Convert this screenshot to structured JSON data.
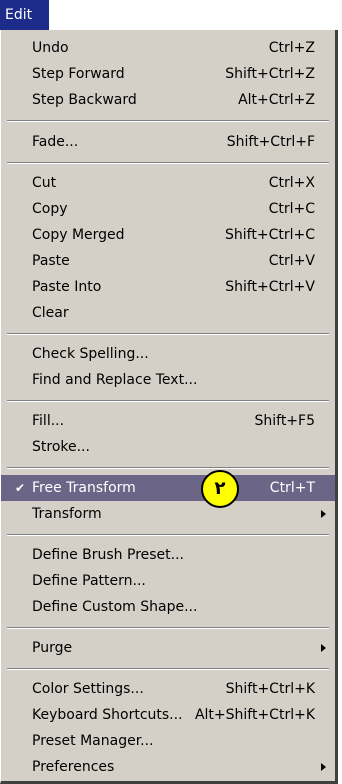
{
  "menubar": {
    "title": "Edit"
  },
  "menu": {
    "undo": {
      "label": "Undo",
      "shortcut": "Ctrl+Z"
    },
    "step_forward": {
      "label": "Step Forward",
      "shortcut": "Shift+Ctrl+Z"
    },
    "step_backward": {
      "label": "Step Backward",
      "shortcut": "Alt+Ctrl+Z"
    },
    "fade": {
      "label": "Fade...",
      "shortcut": "Shift+Ctrl+F"
    },
    "cut": {
      "label": "Cut",
      "shortcut": "Ctrl+X"
    },
    "copy": {
      "label": "Copy",
      "shortcut": "Ctrl+C"
    },
    "copy_merged": {
      "label": "Copy Merged",
      "shortcut": "Shift+Ctrl+C"
    },
    "paste": {
      "label": "Paste",
      "shortcut": "Ctrl+V"
    },
    "paste_into": {
      "label": "Paste Into",
      "shortcut": "Shift+Ctrl+V"
    },
    "clear": {
      "label": "Clear"
    },
    "check_spelling": {
      "label": "Check Spelling..."
    },
    "find_replace": {
      "label": "Find and Replace Text..."
    },
    "fill": {
      "label": "Fill...",
      "shortcut": "Shift+F5"
    },
    "stroke": {
      "label": "Stroke..."
    },
    "free_transform": {
      "label": "Free Transform",
      "shortcut": "Ctrl+T",
      "checked_glyph": "✔"
    },
    "transform": {
      "label": "Transform"
    },
    "define_brush": {
      "label": "Define Brush Preset..."
    },
    "define_pattern": {
      "label": "Define Pattern..."
    },
    "define_shape": {
      "label": "Define Custom Shape..."
    },
    "purge": {
      "label": "Purge"
    },
    "color_settings": {
      "label": "Color Settings...",
      "shortcut": "Shift+Ctrl+K"
    },
    "keyboard_shortcuts": {
      "label": "Keyboard Shortcuts...",
      "shortcut": "Alt+Shift+Ctrl+K"
    },
    "preset_manager": {
      "label": "Preset Manager..."
    },
    "preferences": {
      "label": "Preferences"
    }
  },
  "annotation": {
    "badge_text": "٢"
  },
  "colors": {
    "highlight": "#6b6688",
    "menu_bg": "#d4d0c8",
    "title_bg": "#1d2c8a",
    "badge": "#ffff00"
  }
}
